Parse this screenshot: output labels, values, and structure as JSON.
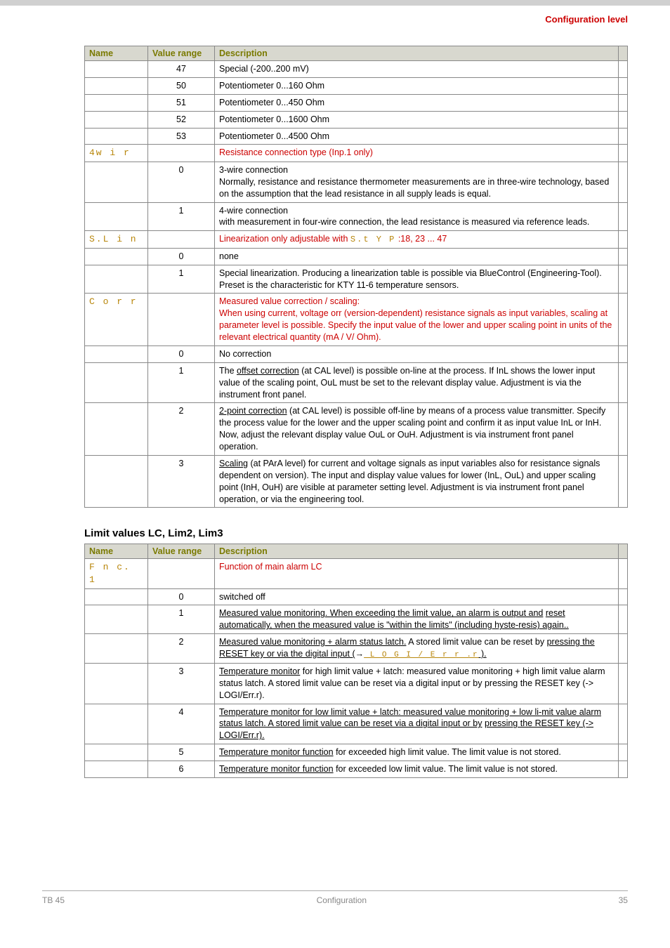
{
  "header": {
    "title": "Configuration level"
  },
  "table1": {
    "headers": {
      "name": "Name",
      "range": "Value range",
      "desc": "Description"
    },
    "empty_rows": [
      {
        "val": "47",
        "desc": "Special (-200..200 mV)"
      },
      {
        "val": "50",
        "desc": "Potentiometer 0...160 Ohm"
      },
      {
        "val": "51",
        "desc": "Potentiometer 0...450 Ohm"
      },
      {
        "val": "52",
        "desc": "Potentiometer 0...1600 Ohm"
      },
      {
        "val": "53",
        "desc": "Potentiometer 0...4500 Ohm"
      }
    ],
    "group_wire": {
      "name": "4w i r",
      "title": "Resistance connection type (Inp.1 only)",
      "rows": [
        {
          "val": "0",
          "desc": "3-wire connection\nNormally, resistance and resistance thermometer measurements are in three-wire technology, based on the assumption that the lead resistance in all supply leads is equal."
        },
        {
          "val": "1",
          "desc": "4-wire connection\nwith measurement in four-wire connection, the lead resistance is measured via reference leads."
        }
      ]
    },
    "group_slin": {
      "name": "S.L i n",
      "title_pre": "Linearization only adjustable with ",
      "title_seg": "S.t Y P",
      "title_post": " :18, 23 ... 47",
      "rows": [
        {
          "val": "0",
          "desc": "none"
        },
        {
          "val": "1",
          "desc": "Special linearization. Producing a linearization table is possible via BlueControl (Engineering-Tool). Preset is the characteristic for KTY 11-6 temperature sensors."
        }
      ]
    },
    "group_corr": {
      "name": "C o r r",
      "title": "Measured value correction / scaling:\nWhen using current, voltage orr (version-dependent) resistance signals as input variables, scaling at parameter level is possible. Specify the input value of the lower and upper scaling point in units of the relevant electrical quantity (mA / V/ Ohm).",
      "rows": [
        {
          "val": "0",
          "desc": "No correction"
        },
        {
          "val": "1",
          "desc_u": "offset correction",
          "desc_pre": "The ",
          "desc_post": " (at CAL level) is possible on-line at the process. If InL shows the lower input value of the scaling point, OuL must be set to the relevant display value. Adjustment is via the instrument  front panel."
        },
        {
          "val": "2",
          "desc_u": "2-point correction",
          "desc_post": " (at CAL level) is possible off-line by means of a process value transmitter. Specify the process value for the lower and the upper scaling point and confirm it as input value InL or InH. Now, adjust the relevant display value OuL or OuH. Adjustment is via instrument front panel operation."
        },
        {
          "val": "3",
          "desc_u": "Scaling",
          "desc_post": " (at PArA level) for current and voltage signals as input variables also for resistance signals dependent on version). The input and display value values for  lower (InL, OuL) and upper scaling point (InH, OuH) are visible at parameter setting level. Adjustment is via instrument front panel operation, or via the engineering tool."
        }
      ]
    }
  },
  "section2_title": "Limit values LC, Lim2, Lim3",
  "table2": {
    "headers": {
      "name": "Name",
      "range": "Value range",
      "desc": "Description"
    },
    "group": {
      "name": "F n c. 1",
      "title": "Function of main alarm LC",
      "rows": {
        "r0": {
          "val": "0",
          "desc": "switched off"
        },
        "r1": {
          "val": "1",
          "u1": "Measured value monitoring. When exceeding the limit value, an alarm is output and",
          "u2": "reset automatically, when the measured value is \"within the limits\"  (including hyste-",
          "u3": "resis) again.."
        },
        "r2": {
          "val": "2",
          "u1": "Measured value monitoring + alarm status latch.",
          "plain": " A stored limit value can be reset by",
          "u2_pre": "pressing the RESET key or via the digital input (",
          "arrow": "→",
          "seg": "  L O G I / E r r .r",
          "u2_post": "  )."
        },
        "r3": {
          "val": "3",
          "u1": "Temperature monitor",
          "plain": " for  high limit value + latch: measured value monitoring + high limit value alarm status latch. A stored limit value can be reset via a digital input or by pressing the RESET key (-> LOGI/Err.r)."
        },
        "r4": {
          "val": "4",
          "u1": "Temperature monitor for low limit value + latch: measured value monitoring + low li-",
          "u2": "mit value alarm status latch. A stored limit value can be reset via a digital input or by",
          "u3": "pressing the RESET key  (-> LOGI/Err.r)."
        },
        "r5": {
          "val": "5",
          "u1": "Temperature monitor function",
          "plain": " for exceeded high limit value. The limit value is not stored."
        },
        "r6": {
          "val": "6",
          "u1": "Temperature monitor function",
          "plain": " for exceeded low limit value. The limit value is not stored."
        }
      }
    }
  },
  "footer": {
    "left": "TB 45",
    "center": "Configuration",
    "right": "35"
  }
}
